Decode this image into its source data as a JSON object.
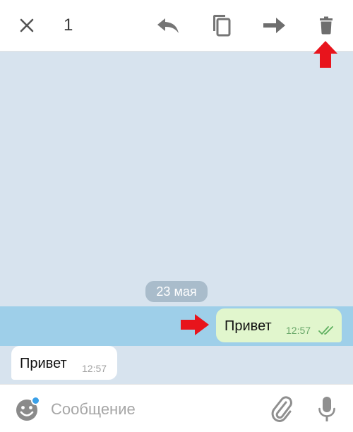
{
  "toolbar": {
    "selected_count": "1",
    "icons": [
      "close-icon",
      "reply-icon",
      "copy-icon",
      "forward-icon",
      "delete-icon"
    ]
  },
  "chat": {
    "date_label": "23 мая",
    "messages": [
      {
        "direction": "outgoing",
        "text": "Привет",
        "time": "12:57",
        "status": "read",
        "selected": true
      },
      {
        "direction": "incoming",
        "text": "Привет",
        "time": "12:57",
        "selected": false
      }
    ]
  },
  "input": {
    "placeholder": "Сообщение",
    "value": ""
  },
  "colors": {
    "chat_background": "#d7e3ee",
    "selected_row": "#9ecfe9",
    "outgoing_bubble": "#e1f6cd",
    "incoming_bubble": "#ffffff",
    "annotation_arrow": "#e8141c",
    "emoji_badge": "#3aa0e8"
  }
}
